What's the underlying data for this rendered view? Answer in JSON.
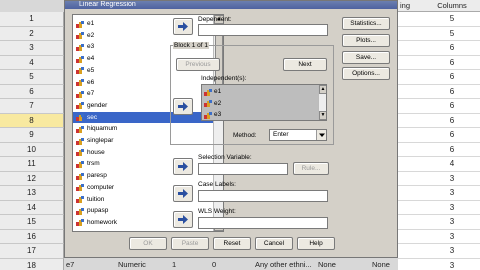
{
  "dialog": {
    "title": "Linear Regression",
    "labels": {
      "dependent": "Dependent:",
      "block": "Block 1 of 1",
      "independents": "Independent(s):",
      "method": "Method:",
      "selection_variable": "Selection Variable:",
      "case_labels": "Case Labels:",
      "wls_weight": "WLS Weight:"
    },
    "buttons": {
      "statistics": "Statistics...",
      "plots": "Plots...",
      "save": "Save...",
      "options": "Options...",
      "previous": "Previous",
      "next": "Next",
      "rule": "Rule...",
      "ok": "OK",
      "paste": "Paste",
      "reset": "Reset",
      "cancel": "Cancel",
      "help": "Help"
    },
    "method_value": "Enter",
    "variables": [
      "e1",
      "e2",
      "e3",
      "e4",
      "e5",
      "e6",
      "e7",
      "gender",
      "sec",
      "hiquamum",
      "singlepar",
      "house",
      "trsm",
      "paresp",
      "computer",
      "tuition",
      "pupasp",
      "homework"
    ],
    "selected_variable": "sec",
    "independents": [
      "e1",
      "e2",
      "e3"
    ]
  },
  "background": {
    "rows": [
      "1",
      "2",
      "3",
      "4",
      "5",
      "6",
      "7",
      "8",
      "9",
      "10",
      "11",
      "12",
      "13",
      "14",
      "15",
      "16",
      "17",
      "18"
    ],
    "selected_row": "8",
    "header_right": [
      "ing",
      "Columns"
    ],
    "columns_values": [
      "5",
      "5",
      "6",
      "6",
      "6",
      "6",
      "6",
      "6",
      "6",
      "6",
      "4",
      "3",
      "3",
      "3",
      "3",
      "3",
      "3",
      "3"
    ],
    "row18": [
      "e7",
      "Numeric",
      "1",
      "0",
      "Any other ethni...",
      "None",
      "None"
    ]
  }
}
